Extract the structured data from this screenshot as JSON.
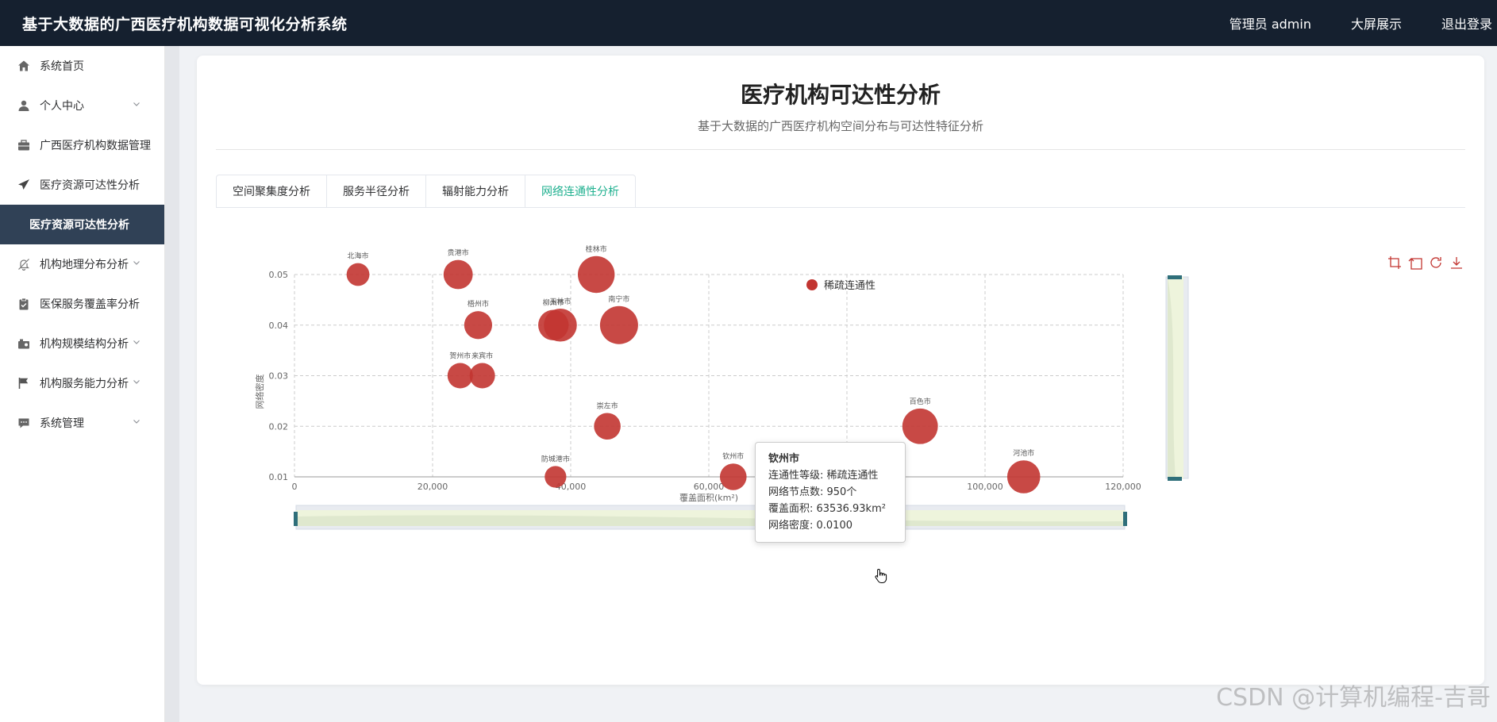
{
  "header": {
    "app_title": "基于大数据的广西医疗机构数据可视化分析系统",
    "user_label": "管理员 admin",
    "big_screen_label": "大屏展示",
    "logout_label": "退出登录"
  },
  "sidebar": {
    "items": [
      {
        "label": "系统首页",
        "icon": "home-icon",
        "has_children": false
      },
      {
        "label": "个人中心",
        "icon": "user-icon",
        "has_children": true
      },
      {
        "label": "广西医疗机构数据管理",
        "icon": "briefcase-icon",
        "has_children": false
      },
      {
        "label": "医疗资源可达性分析",
        "icon": "send-icon",
        "has_children": false
      },
      {
        "label": "医疗资源可达性分析",
        "icon": "",
        "has_children": false,
        "active": true
      },
      {
        "label": "机构地理分布分析",
        "icon": "bell-off-icon",
        "has_children": true
      },
      {
        "label": "医保服务覆盖率分析",
        "icon": "clipboard-icon",
        "has_children": false
      },
      {
        "label": "机构规模结构分析",
        "icon": "camera-icon",
        "has_children": true
      },
      {
        "label": "机构服务能力分析",
        "icon": "flag-icon",
        "has_children": true
      },
      {
        "label": "系统管理",
        "icon": "chat-icon",
        "has_children": true
      }
    ]
  },
  "page": {
    "title": "医疗机构可达性分析",
    "subtitle": "基于大数据的广西医疗机构空间分布与可达性特征分析"
  },
  "tabs": [
    {
      "label": "空间聚集度分析",
      "active": false
    },
    {
      "label": "服务半径分析",
      "active": false
    },
    {
      "label": "辐射能力分析",
      "active": false
    },
    {
      "label": "网络连通性分析",
      "active": true
    }
  ],
  "chart_data": {
    "type": "scatter",
    "title": "",
    "xlabel": "覆盖面积(km²)",
    "ylabel": "网络密度",
    "xlim": [
      0,
      120000
    ],
    "ylim": [
      0.01,
      0.05
    ],
    "x_ticks": [
      "0",
      "20,000",
      "40,000",
      "60,000",
      "80,000",
      "100,000",
      "120,000"
    ],
    "y_ticks": [
      "0.01",
      "0.02",
      "0.03",
      "0.04",
      "0.05"
    ],
    "grid": true,
    "legend": [
      "稀疏连通性"
    ],
    "legend_placement": "top-center",
    "color": "#c23531",
    "series": [
      {
        "name": "稀疏连通性",
        "points": [
          {
            "city": "北海市",
            "x": 9200,
            "y": 0.05,
            "size": 0.4
          },
          {
            "city": "贵港市",
            "x": 23700,
            "y": 0.05,
            "size": 0.65
          },
          {
            "city": "桂林市",
            "x": 43700,
            "y": 0.05,
            "size": 0.95
          },
          {
            "city": "梧州市",
            "x": 26600,
            "y": 0.04,
            "size": 0.6
          },
          {
            "city": "柳州市",
            "x": 37500,
            "y": 0.04,
            "size": 0.7
          },
          {
            "city": "玉林市",
            "x": 38500,
            "y": 0.04,
            "size": 0.8
          },
          {
            "city": "南宁市",
            "x": 47000,
            "y": 0.04,
            "size": 1.0
          },
          {
            "city": "贺州市",
            "x": 24000,
            "y": 0.03,
            "size": 0.5
          },
          {
            "city": "来宾市",
            "x": 27200,
            "y": 0.03,
            "size": 0.5
          },
          {
            "city": "崇左市",
            "x": 45300,
            "y": 0.02,
            "size": 0.55
          },
          {
            "city": "百色市",
            "x": 90600,
            "y": 0.02,
            "size": 0.9
          },
          {
            "city": "防城港市",
            "x": 37800,
            "y": 0.01,
            "size": 0.35
          },
          {
            "city": "钦州市",
            "x": 63536.93,
            "y": 0.01,
            "size": 0.55
          },
          {
            "city": "河池市",
            "x": 105600,
            "y": 0.01,
            "size": 0.8
          }
        ]
      }
    ],
    "data_zoom": true
  },
  "tooltip": {
    "title": "钦州市",
    "lines": [
      "连通性等级: 稀疏连通性",
      "网络节点数: 950个",
      "覆盖面积: 63536.93km²",
      "网络密度: 0.0100"
    ]
  },
  "watermark": "CSDN @计算机编程-吉哥"
}
